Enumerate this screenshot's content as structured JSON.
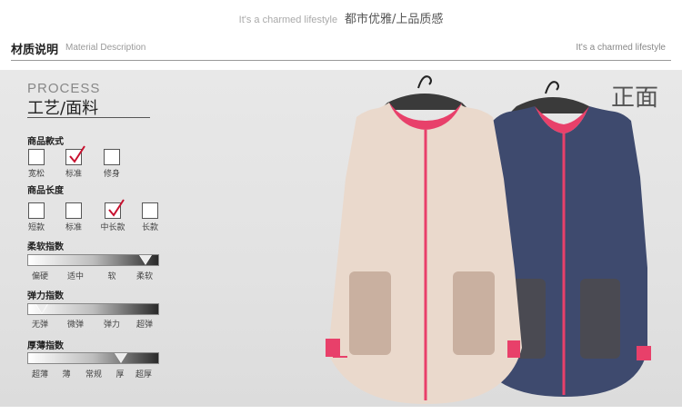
{
  "tagline": {
    "en": "It's a charmed lifestyle",
    "cn": "都市优雅/上品质感"
  },
  "section": {
    "title_cn": "材质说明",
    "title_en": "Material Description",
    "right_tag": "It's a charmed lifestyle"
  },
  "process": {
    "title_en": "PROCESS",
    "title_cn": "工艺/面料"
  },
  "style_group": {
    "title": "商品款式",
    "options": [
      {
        "label": "宽松",
        "checked": false
      },
      {
        "label": "标准",
        "checked": true
      },
      {
        "label": "修身",
        "checked": false
      }
    ]
  },
  "length_group": {
    "title": "商品长度",
    "options": [
      {
        "label": "短款",
        "checked": false
      },
      {
        "label": "标准",
        "checked": false
      },
      {
        "label": "中长款",
        "checked": true
      },
      {
        "label": "长款",
        "checked": false
      }
    ]
  },
  "softness": {
    "title": "柔软指数",
    "labels": [
      "偏硬",
      "适中",
      "软",
      "柔软"
    ],
    "level": "柔软"
  },
  "elasticity": {
    "title": "弹力指数",
    "labels": [
      "无弹",
      "微弹",
      "弹力",
      "超弹"
    ],
    "level": "无弹"
  },
  "thickness": {
    "title": "厚薄指数",
    "labels": [
      "超薄",
      "薄",
      "常规",
      "厚",
      "超厚"
    ],
    "level": "厚"
  },
  "view_label": "正面",
  "colors": {
    "beige_coat": "#ead9cc",
    "navy_coat": "#3e4a6e",
    "trim": "#e8406a",
    "fur": "#c9b0a0"
  }
}
